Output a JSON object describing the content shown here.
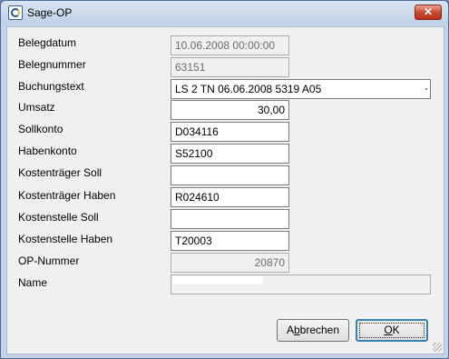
{
  "window": {
    "title": "Sage-OP",
    "close_glyph": "✕",
    "icon": "sage-app-icon"
  },
  "form": {
    "fields": [
      {
        "label": "Belegdatum",
        "value": "10.06.2008 00:00:00",
        "enabled": false
      },
      {
        "label": "Belegnummer",
        "value": "63151",
        "enabled": false
      },
      {
        "label": "Buchungstext",
        "value": "LS 2 TN 06.06.2008 5319 A05",
        "enabled": true
      },
      {
        "label": "Umsatz",
        "value": "30,00",
        "enabled": true
      },
      {
        "label": "Sollkonto",
        "value": "D034116",
        "enabled": true
      },
      {
        "label": "Habenkonto",
        "value": "S52100",
        "enabled": true
      },
      {
        "label": "Kostenträger Soll",
        "value": "",
        "enabled": true
      },
      {
        "label": "Kostenträger Haben",
        "value": "R024610",
        "enabled": true
      },
      {
        "label": "Kostenstelle Soll",
        "value": "",
        "enabled": true
      },
      {
        "label": "Kostenstelle Haben",
        "value": "T20003",
        "enabled": true
      },
      {
        "label": "OP-Nummer",
        "value": "20870",
        "enabled": false
      },
      {
        "label": "Name",
        "value": "",
        "enabled": false
      }
    ]
  },
  "buttons": {
    "cancel": {
      "pre": "A",
      "mnemonic": "b",
      "post": "brechen"
    },
    "ok": {
      "mnemonic": "O",
      "post": "K"
    }
  }
}
